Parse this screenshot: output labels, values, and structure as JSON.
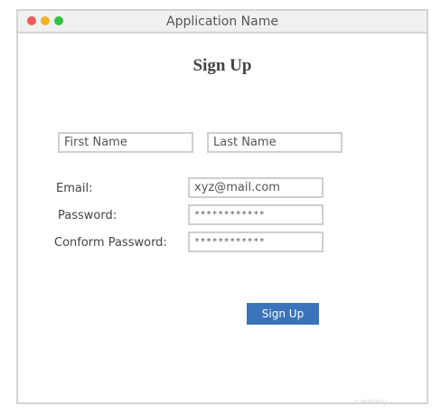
{
  "window": {
    "title": "Application Name",
    "controls": {
      "close_color": "#ef5b5b",
      "minimize_color": "#f0b429",
      "maximize_color": "#34c240"
    }
  },
  "form": {
    "title": "Sign Up",
    "first_name": {
      "value": "First Name"
    },
    "last_name": {
      "value": "Last Name"
    },
    "email": {
      "label": "Email:",
      "value": "xyz@mail.com"
    },
    "password": {
      "label": "Password:",
      "value": "************"
    },
    "confirm_password": {
      "label": "Conform Password:",
      "value": "************"
    },
    "submit_label": "Sign Up",
    "submit_color": "#3a73b9"
  },
  "watermark": {
    "text": "creately",
    "accent_color": "#f4b251"
  }
}
